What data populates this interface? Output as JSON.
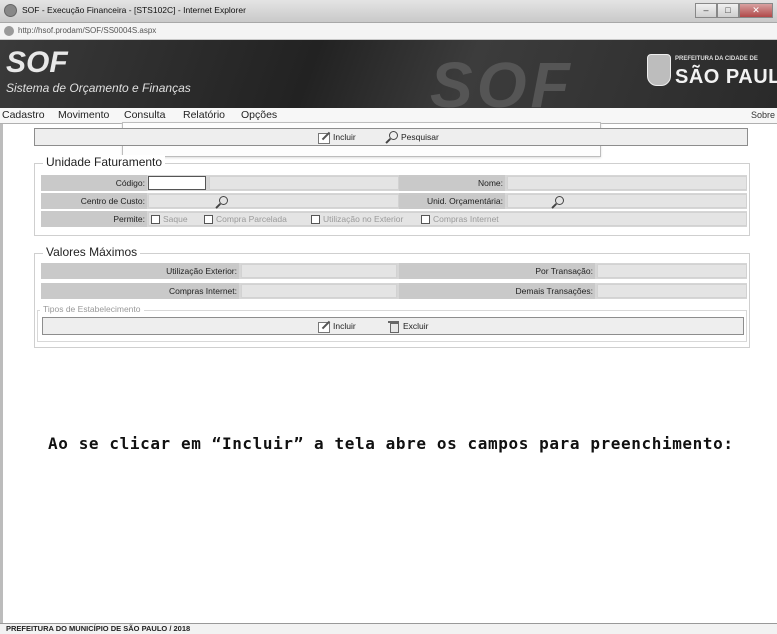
{
  "window": {
    "title": "SOF - Execução Financeira - [STS102C] - Internet Explorer",
    "url": "http://hsof.prodam/SOF/SS0004S.aspx"
  },
  "header": {
    "app_name": "SOF",
    "app_subtitle": "Sistema de Orçamento e Finanças",
    "logo_small": "PREFEITURA DA CIDADE DE",
    "logo_big": "SÃO PAULO"
  },
  "menu": {
    "items": [
      "Cadastro",
      "Movimento",
      "Consulta",
      "Relatório",
      "Opções"
    ],
    "right": "Sobre"
  },
  "toolbar": {
    "incluir": "Incluir",
    "pesquisar": "Pesquisar"
  },
  "unidade": {
    "legend": "Unidade Faturamento",
    "codigo_label": "Código:",
    "nome_label": "Nome:",
    "centro_label": "Centro de Custo:",
    "unid_orc_label": "Unid. Orçamentária:",
    "permite_label": "Permite:",
    "options": [
      "Saque",
      "Compra Parcelada",
      "Utilização no Exterior",
      "Compras Internet"
    ]
  },
  "valores": {
    "legend": "Valores Máximos",
    "util_ext_label": "Utilização Exterior:",
    "por_transacao_label": "Por Transação:",
    "compras_int_label": "Compras Internet:",
    "demais_label": "Demais Transações:"
  },
  "tipos": {
    "legend": "Tipos de Estabelecimento",
    "incluir": "Incluir",
    "excluir": "Excluir"
  },
  "note": "Ao se clicar em “Incluir” a tela abre os campos para preenchimento:",
  "footer": "PREFEITURA DO MUNICÍPIO DE SÃO PAULO / 2018"
}
